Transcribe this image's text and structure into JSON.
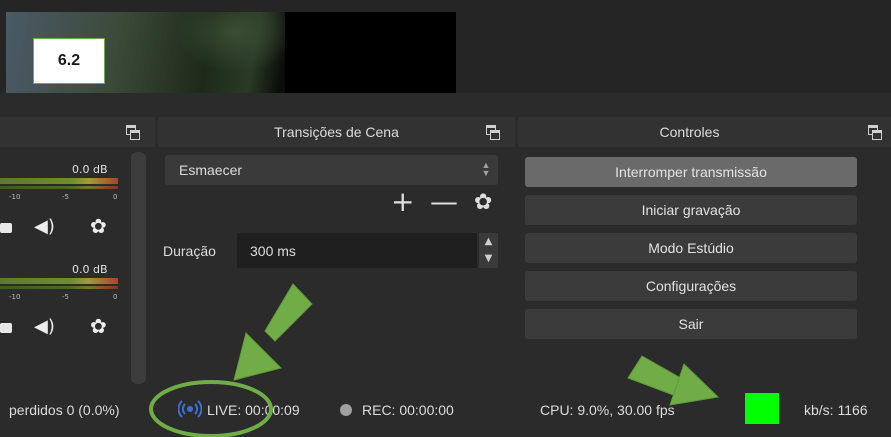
{
  "annotation": {
    "badge_text": "6.2"
  },
  "mixer": {
    "tracks": [
      {
        "level": "0.0 dB",
        "scale": [
          "-10",
          "-5",
          "0"
        ]
      },
      {
        "level": "0.0 dB",
        "scale": [
          "-10",
          "-5",
          "0"
        ]
      }
    ]
  },
  "transitions": {
    "title": "Transições de Cena",
    "selected": "Esmaecer",
    "add_symbol": "+",
    "remove_symbol": "—",
    "duration_label": "Duração",
    "duration_value": "300 ms"
  },
  "controls": {
    "title": "Controles",
    "buttons": [
      "Interromper transmissão",
      "Iniciar gravação",
      "Modo Estúdio",
      "Configurações",
      "Sair"
    ]
  },
  "status": {
    "dropped": "perdidos 0 (0.0%)",
    "live": "LIVE: 00:00:09",
    "rec": "REC: 00:00:00",
    "cpu": "CPU: 9.0%, 30.00 fps",
    "bitrate": "kb/s: 1166",
    "indicator_color": "#00ff00"
  },
  "colors": {
    "annotation_green": "#70ad47",
    "live_icon": "#3d6fd8"
  }
}
